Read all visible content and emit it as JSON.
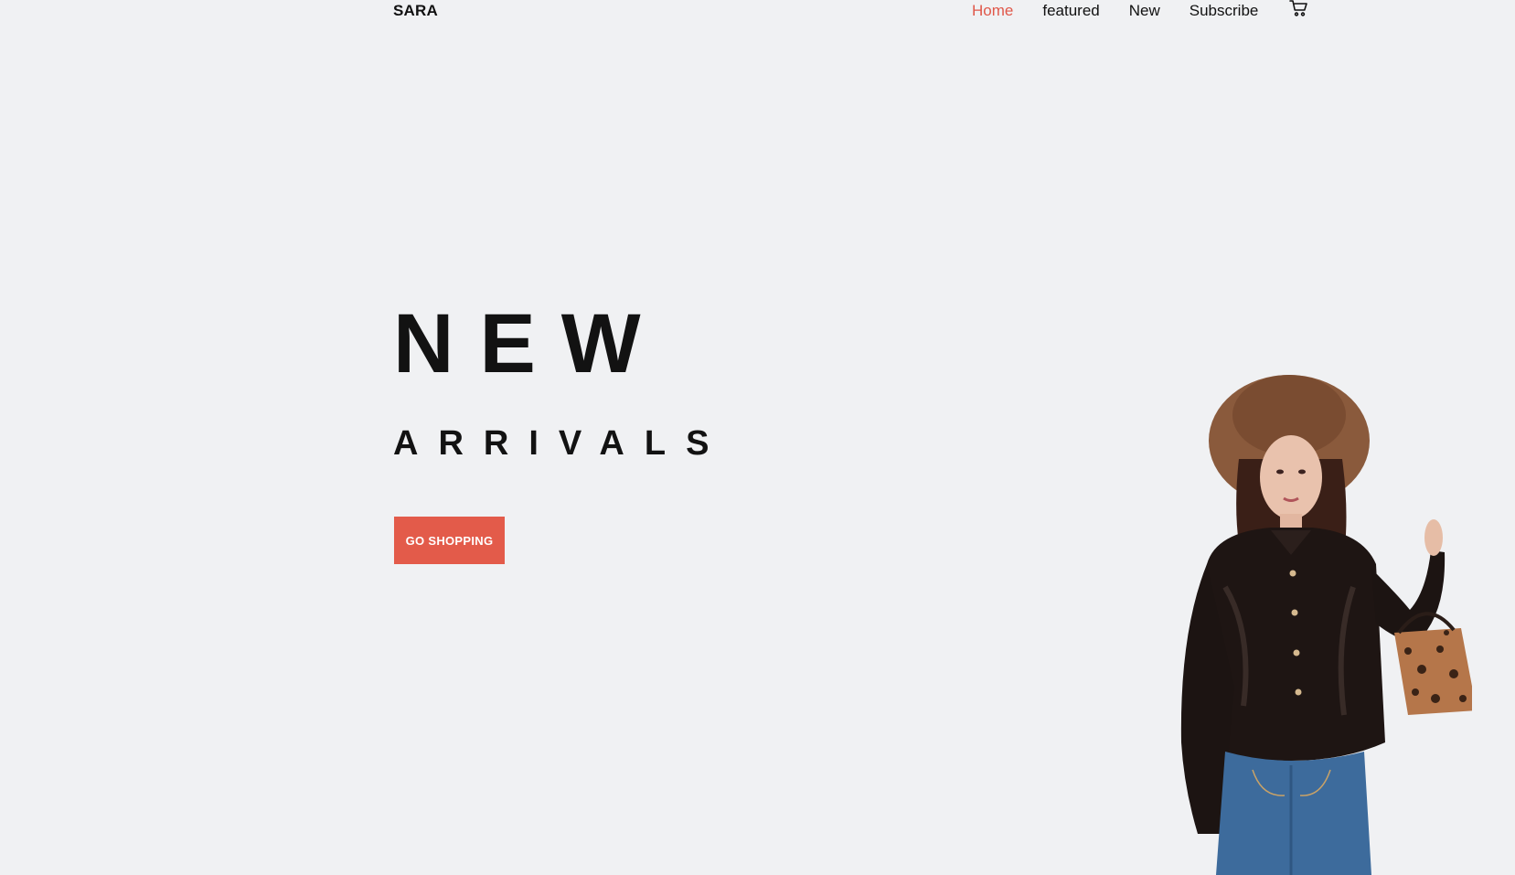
{
  "brand": "SARA",
  "nav": {
    "home": "Home",
    "featured": "featured",
    "new": "New",
    "subscribe": "Subscribe",
    "cart_icon": "cart-icon"
  },
  "hero": {
    "line1": "NEW",
    "line2": "ARRIVALS",
    "cta": "GO SHOPPING"
  },
  "colors": {
    "accent": "#e35b4a",
    "background": "#f0f1f3",
    "text": "#111111"
  },
  "image": {
    "subject": "woman-in-hat-leather-shirt-jeans-leopard-bag"
  }
}
